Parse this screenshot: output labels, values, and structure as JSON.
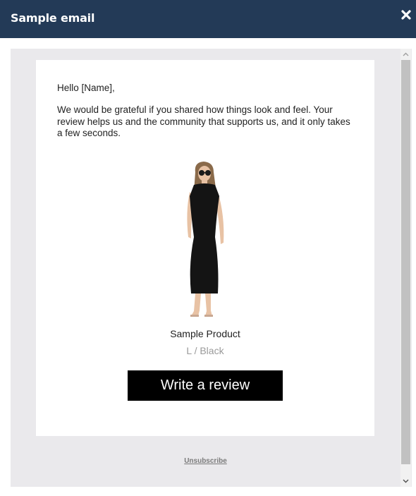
{
  "modal": {
    "title": "Sample email",
    "close_icon": "close-icon"
  },
  "email": {
    "greeting": "Hello [Name],",
    "body": "We would be grateful if you shared how things look and feel. Your review helps us and the community that supports us, and it only takes a few seconds.",
    "product": {
      "name": "Sample Product",
      "variant": "L / Black",
      "image": "product-photo-black-dress"
    },
    "cta_label": "Write a review",
    "unsubscribe_label": "Unsubscribe"
  },
  "colors": {
    "header_bg": "#233a57",
    "page_bg": "#eae9ec",
    "button_bg": "#000000",
    "muted_text": "#9a9a9a"
  }
}
